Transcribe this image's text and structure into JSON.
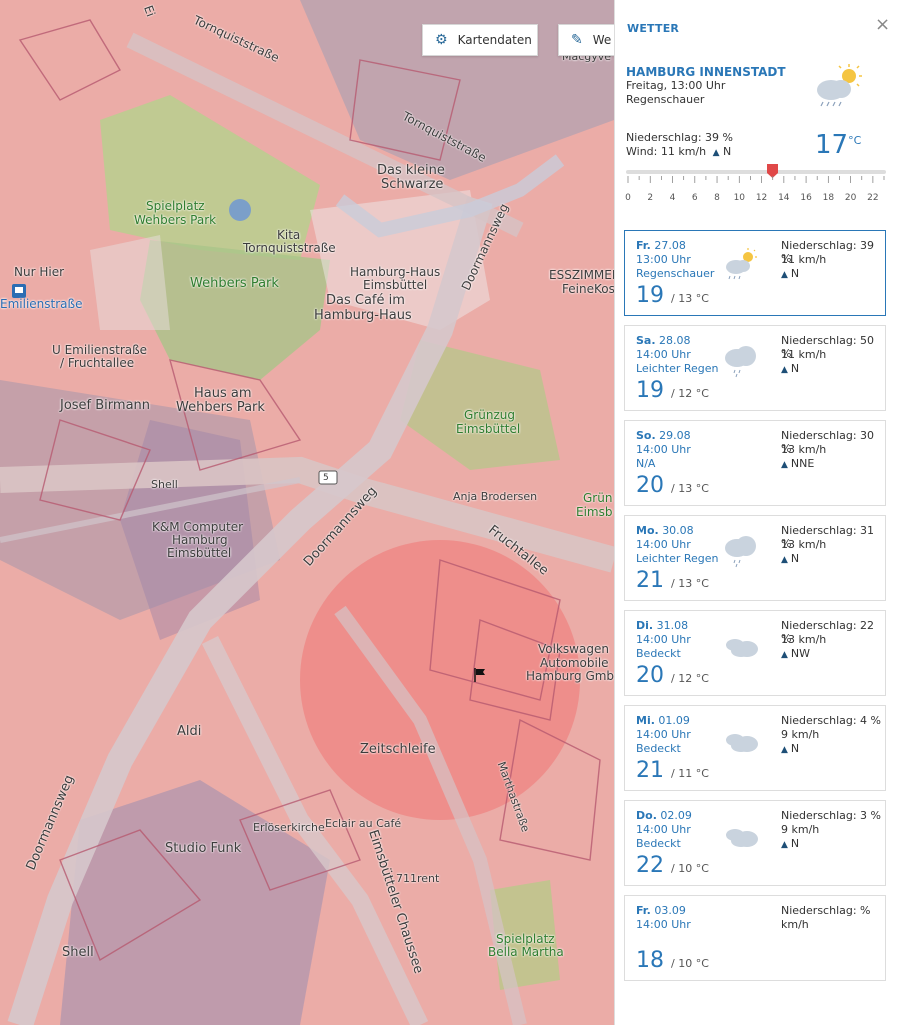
{
  "map": {
    "labels": {
      "tornquist_1": "Tornquiststraße",
      "tornquist_2": "Tornquiststraße",
      "das_kleine": "Das kleine",
      "schwarze": "Schwarze",
      "spielplatz_wp_1": "Spielplatz",
      "spielplatz_wp_2": "Wehbers Park",
      "kita_1": "Kita",
      "kita_2": "Tornquiststraße",
      "hh_haus_1": "Hamburg-Haus",
      "hh_haus_2": "Eimsbüttel",
      "wehbers_park": "Wehbers Park",
      "cafe_1": "Das Café im",
      "cafe_2": "Hamburg-Haus",
      "nur_hier": "Nur Hier",
      "emilienstr": "Emilienstraße",
      "u_emilien_1": "U Emilienstraße",
      "u_emilien_2": "/ Fruchtallee",
      "doormannsweg_1": "Doormannsweg",
      "esszimmer_1": "ESSZIMMER",
      "esszimmer_2": "FeineKos",
      "haus_am_1": "Haus am",
      "haus_am_2": "Wehbers Park",
      "josef": "Josef Birmann",
      "gruenzug_1": "Grünzug",
      "gruenzug_2": "Eimsbüttel",
      "shell_1": "Shell",
      "route_5": "5",
      "anja": "Anja Brodersen",
      "gruen_1": "Grün",
      "gruen_2": "Eimsb",
      "km_1": "K&M Computer",
      "km_2": "Hamburg",
      "km_3": "Eimsbüttel",
      "doormannsweg_2": "Doormannsweg",
      "fruchtallee": "Fruchtallee",
      "vw_1": "Volkswagen",
      "vw_2": "Automobile",
      "vw_3": "Hamburg Gmb",
      "aldi": "Aldi",
      "zeitschleife": "Zeitschleife",
      "doormannsweg_3": "Doormannsweg",
      "martha": "Marthastraße",
      "erloeser": "Erlöserkirche",
      "eclair": "Eclair au Café",
      "studio": "Studio Funk",
      "eimsb_ch": "Eimsbütteler Chaussee",
      "rent": "711rent",
      "shell_2": "Shell",
      "spielplatz_bm_1": "Spielplatz",
      "spielplatz_bm_2": "Bella Martha",
      "macgyver": "Macgyve",
      "eimsb_top": "Ei"
    }
  },
  "toolbar": {
    "kartendaten_label": "Kartendaten",
    "wetter_label": "We"
  },
  "panel": {
    "title": "WETTER",
    "close": "×",
    "location": "HAMBURG INNENSTADT",
    "datetime": "Freitag, 13:00 Uhr",
    "condition": "Regenschauer",
    "precip": "Niederschlag: 39 %",
    "wind": "Wind: 11 km/h",
    "wind_dir": "N",
    "temp": "17",
    "temp_unit": "°C",
    "slider": {
      "value": 13,
      "min": 0,
      "max": 23
    },
    "tick_labels": [
      "0",
      "2",
      "4",
      "6",
      "8",
      "10",
      "12",
      "14",
      "16",
      "18",
      "20",
      "22"
    ]
  },
  "forecast": [
    {
      "day": "Fr.",
      "date": "27.08",
      "time": "13:00 Uhr",
      "desc": "Regenschauer",
      "temp": "19",
      "low": "/ 13 °C",
      "precip": "Niederschlag: 39 %",
      "wind": "11 km/h",
      "dir": "N",
      "icon": "sun-cloud-rain-icon"
    },
    {
      "day": "Sa.",
      "date": "28.08",
      "time": "14:00 Uhr",
      "desc": "Leichter Regen",
      "temp": "19",
      "low": "/ 12 °C",
      "precip": "Niederschlag: 50 %",
      "wind": "11 km/h",
      "dir": "N",
      "icon": "cloud-rain-icon"
    },
    {
      "day": "So.",
      "date": "29.08",
      "time": "14:00 Uhr",
      "desc": "N/A",
      "temp": "20",
      "low": "/ 13 °C",
      "precip": "Niederschlag: 30 %",
      "wind": "13 km/h",
      "dir": "NNE",
      "icon": ""
    },
    {
      "day": "Mo.",
      "date": "30.08",
      "time": "14:00 Uhr",
      "desc": "Leichter Regen",
      "temp": "21",
      "low": "/ 13 °C",
      "precip": "Niederschlag: 31 %",
      "wind": "13 km/h",
      "dir": "N",
      "icon": "cloud-rain-icon"
    },
    {
      "day": "Di.",
      "date": "31.08",
      "time": "14:00 Uhr",
      "desc": "Bedeckt",
      "temp": "20",
      "low": "/ 12 °C",
      "precip": "Niederschlag: 22 %",
      "wind": "13 km/h",
      "dir": "NW",
      "icon": "clouds-icon"
    },
    {
      "day": "Mi.",
      "date": "01.09",
      "time": "14:00 Uhr",
      "desc": "Bedeckt",
      "temp": "21",
      "low": "/ 11 °C",
      "precip": "Niederschlag: 4 %",
      "wind": "9 km/h",
      "dir": "N",
      "icon": "clouds-icon"
    },
    {
      "day": "Do.",
      "date": "02.09",
      "time": "14:00 Uhr",
      "desc": "Bedeckt",
      "temp": "22",
      "low": "/ 10 °C",
      "precip": "Niederschlag: 3 %",
      "wind": "9 km/h",
      "dir": "N",
      "icon": "clouds-icon"
    },
    {
      "day": "Fr.",
      "date": "03.09",
      "time": "14:00 Uhr",
      "desc": "",
      "temp": "18",
      "low": "/ 10 °C",
      "precip": "Niederschlag: %",
      "wind": "km/h",
      "dir": "",
      "icon": ""
    }
  ]
}
